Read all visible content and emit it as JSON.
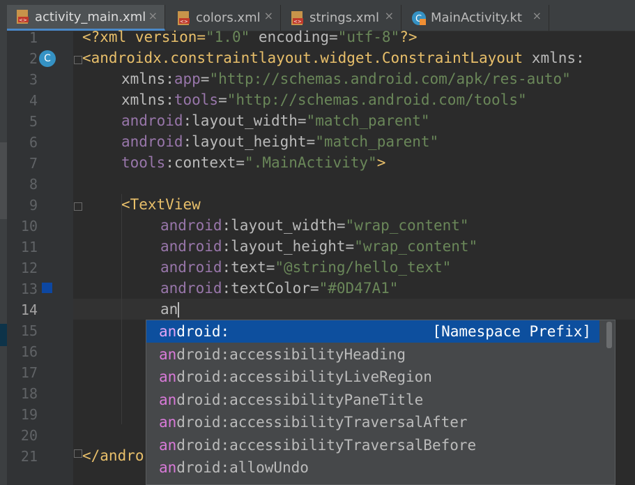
{
  "tabs": [
    {
      "label": "activity_main.xml",
      "icon": "xml-file-icon",
      "active": true
    },
    {
      "label": "colors.xml",
      "icon": "xml-file-icon",
      "active": false
    },
    {
      "label": "strings.xml",
      "icon": "xml-file-icon",
      "active": false
    },
    {
      "label": "MainActivity.kt",
      "icon": "kotlin-class-icon",
      "active": false
    }
  ],
  "close_glyph": "×",
  "gutter": {
    "line_numbers": [
      "1",
      "2",
      "3",
      "4",
      "5",
      "6",
      "7",
      "8",
      "9",
      "10",
      "11",
      "12",
      "13",
      "14",
      "15",
      "16",
      "17",
      "18",
      "19",
      "20",
      "21"
    ],
    "class_marker": "C",
    "color_swatch": "#0D47A1"
  },
  "code": {
    "l1": {
      "a": "<?xml version=",
      "b": "\"1.0\"",
      "c": " encoding=",
      "d": "\"utf-8\"",
      "e": "?>"
    },
    "l2": {
      "tag": "<androidx.constraintlayout.widget.ConstraintLayout",
      "attr": " xmlns:"
    },
    "l3": {
      "a": "xmlns:",
      "ns": "app",
      "eq": "=",
      "val": "\"http://schemas.android.com/apk/res-auto\""
    },
    "l4": {
      "a": "xmlns:",
      "ns": "tools",
      "eq": "=",
      "val": "\"http://schemas.android.com/tools\""
    },
    "l5": {
      "ns": "android",
      "attr": ":layout_width",
      "eq": "=",
      "val": "\"match_parent\""
    },
    "l6": {
      "ns": "android",
      "attr": ":layout_height",
      "eq": "=",
      "val": "\"match_parent\""
    },
    "l7": {
      "ns": "tools",
      "attr": ":context",
      "eq": "=",
      "val": "\".MainActivity\"",
      "end": ">"
    },
    "l9": {
      "tag": "<TextView"
    },
    "l10": {
      "ns": "android",
      "attr": ":layout_width",
      "eq": "=",
      "val": "\"wrap_content\""
    },
    "l11": {
      "ns": "android",
      "attr": ":layout_height",
      "eq": "=",
      "val": "\"wrap_content\""
    },
    "l12": {
      "ns": "android",
      "attr": ":text",
      "eq": "=",
      "val": "\"@string/hello_text\""
    },
    "l13": {
      "ns": "android",
      "attr": ":textColor",
      "eq": "=",
      "val": "\"#0D47A1\""
    },
    "l14": {
      "typed": "an"
    },
    "l21": {
      "tag": "</andro"
    }
  },
  "autocomplete": {
    "match": "an",
    "items": [
      {
        "rest": "droid:",
        "hint": "[Namespace Prefix]",
        "selected": true
      },
      {
        "rest": "droid:accessibilityHeading",
        "hint": "",
        "selected": false
      },
      {
        "rest": "droid:accessibilityLiveRegion",
        "hint": "",
        "selected": false
      },
      {
        "rest": "droid:accessibilityPaneTitle",
        "hint": "",
        "selected": false
      },
      {
        "rest": "droid:accessibilityTraversalAfter",
        "hint": "",
        "selected": false
      },
      {
        "rest": "droid:accessibilityTraversalBefore",
        "hint": "",
        "selected": false
      },
      {
        "rest": "droid:allowUndo",
        "hint": "",
        "selected": false
      }
    ]
  },
  "colors": {
    "background": "#2b2b2b",
    "selection": "#0d4f9e",
    "tag": "#e8bf6a",
    "namespace": "#9876aa",
    "string": "#6a8759"
  }
}
